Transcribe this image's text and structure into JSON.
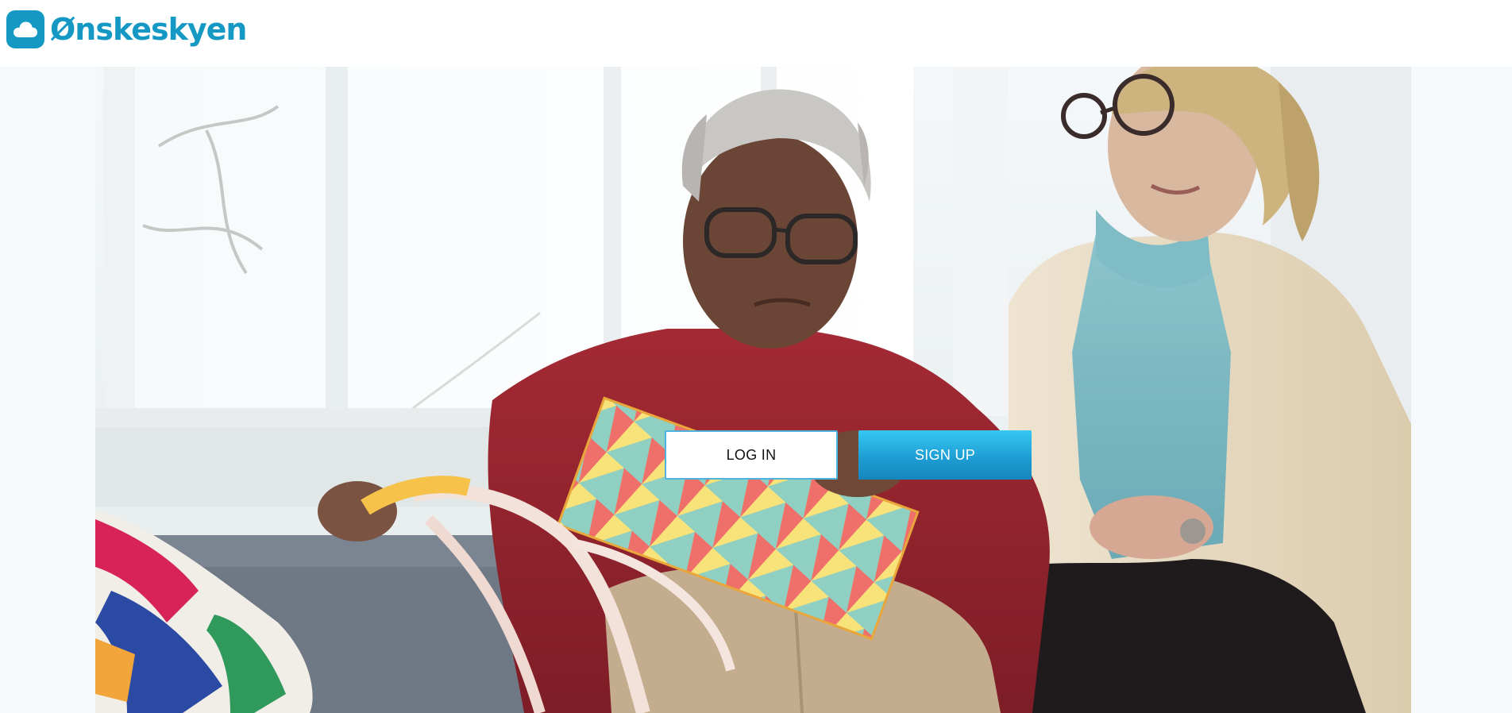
{
  "brand": {
    "name": "Ønskeskyen",
    "color": "#1599c4",
    "icon": "cloud-icon"
  },
  "hero": {
    "image": "hero-photo-gift-opening"
  },
  "actions": {
    "login_label": "LOG IN",
    "signup_label": "SIGN UP",
    "signup_color": "#1fa6dc"
  }
}
